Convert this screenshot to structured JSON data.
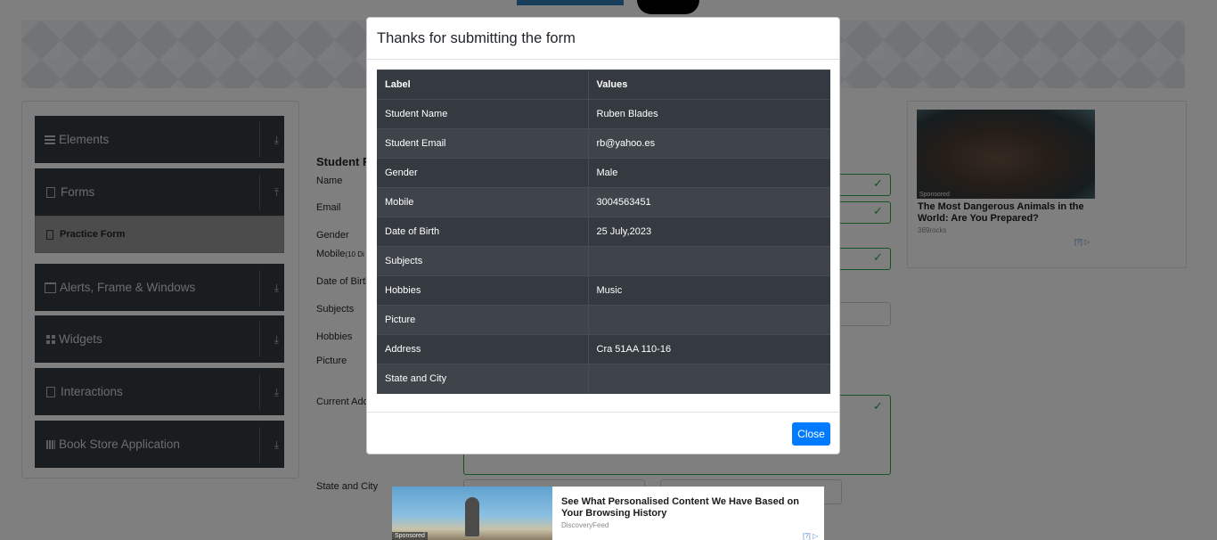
{
  "sidebar": {
    "groups": [
      {
        "label": "Elements",
        "icon": "list-icon"
      },
      {
        "label": "Forms",
        "icon": "document-icon"
      },
      {
        "label": "Alerts, Frame & Windows",
        "icon": "window-icon"
      },
      {
        "label": "Widgets",
        "icon": "grid-icon"
      },
      {
        "label": "Interactions",
        "icon": "document-icon"
      },
      {
        "label": "Book Store Application",
        "icon": "books-icon"
      }
    ],
    "active_item": "Practice Form"
  },
  "form": {
    "title": "Student R",
    "labels": {
      "name": "Name",
      "email": "Email",
      "gender": "Gender",
      "mobile": "Mobile",
      "mobile_hint": "(10 Di",
      "dob": "Date of Birth",
      "subjects": "Subjects",
      "hobbies": "Hobbies",
      "picture": "Picture",
      "address": "Current Add",
      "state_city": "State and City"
    }
  },
  "modal": {
    "title": "Thanks for submitting the form",
    "table": {
      "headers": [
        "Label",
        "Values"
      ],
      "rows": [
        [
          "Student Name",
          "Ruben Blades"
        ],
        [
          "Student Email",
          "rb@yahoo.es"
        ],
        [
          "Gender",
          "Male"
        ],
        [
          "Mobile",
          "3004563451"
        ],
        [
          "Date of Birth",
          "25 July,2023"
        ],
        [
          "Subjects",
          ""
        ],
        [
          "Hobbies",
          "Music"
        ],
        [
          "Picture",
          ""
        ],
        [
          "Address",
          "Cra 51AA 110-16"
        ],
        [
          "State and City",
          ""
        ]
      ]
    },
    "close_label": "Close"
  },
  "ads": {
    "right": {
      "tag": "Sponsored",
      "title": "The Most Dangerous Animals in the World: Are You Prepared?",
      "source": "369rocks",
      "choice": "[?]"
    },
    "bottom": {
      "tag": "Sponsored",
      "title": "See What Personalised Content We Have Based on Your Browsing History",
      "source": "DiscoveryFeed",
      "choice": "[?]"
    }
  },
  "colors": {
    "sidebar_bg": "#343a40",
    "table_bg": "#343a40",
    "accent": "#007bff",
    "valid": "#28a745"
  }
}
